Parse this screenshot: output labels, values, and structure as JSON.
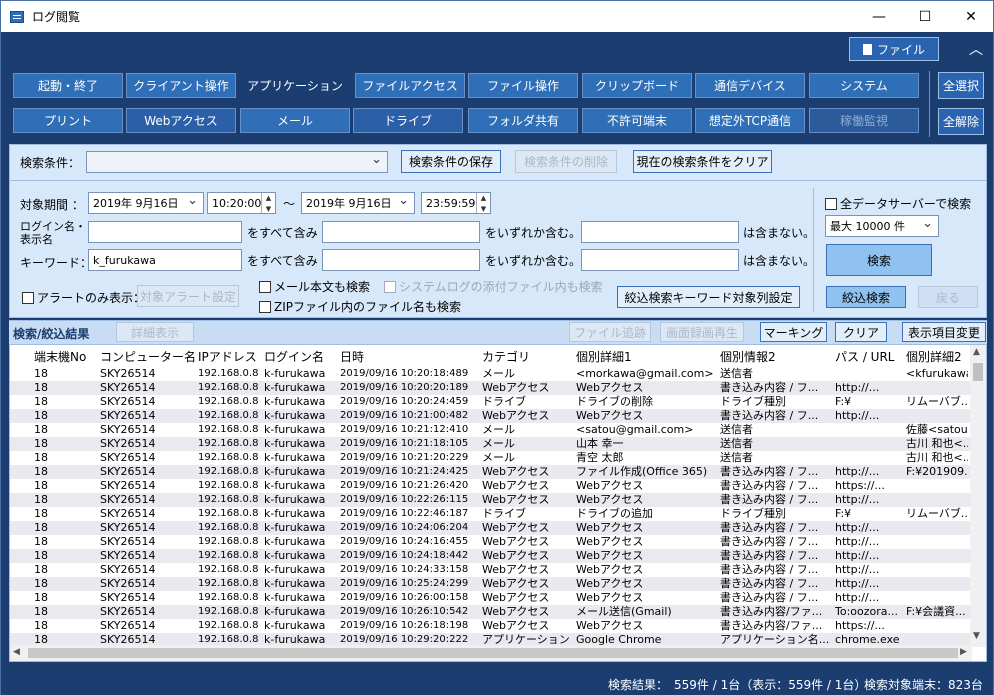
{
  "window": {
    "title": "ログ閲覧",
    "minimize": "—",
    "maximize": "☐",
    "close": "✕"
  },
  "header": {
    "file_button": "ファイル",
    "collapse": "︿"
  },
  "categories_row1": [
    "起動・終了",
    "クライアント操作",
    "アプリケーション",
    "ファイルアクセス",
    "ファイル操作",
    "クリップボード",
    "通信デバイス",
    "システム"
  ],
  "categories_row2": [
    "プリント",
    "Webアクセス",
    "メール",
    "ドライブ",
    "フォルダ共有",
    "不許可端末",
    "想定外TCP通信",
    "稼働監視"
  ],
  "select_all": "全選択",
  "deselect_all": "全解除",
  "search": {
    "condition_label": "検索条件：",
    "condition_value": "",
    "save_btn": "検索条件の保存",
    "delete_btn": "検索条件の削除",
    "clear_btn": "現在の検索条件をクリア",
    "period_label": "対象期間 ：",
    "date_from": "2019年 9月16日",
    "time_from": "10:20:00",
    "tilde": "〜",
    "date_to": "2019年 9月16日",
    "time_to": "23:59:59",
    "login_label1": "ログイン名・",
    "login_label2": "表示名",
    "all_contain": "をすべて含み",
    "any_contain": "をいずれか含む。",
    "not_contain": "は含まない。",
    "keyword_label": "キーワード：",
    "keyword_value": "k_furukawa",
    "alert_only": "アラートのみ表示：",
    "alert_setting": "対象アラート設定",
    "mail_body": "メール本文も検索",
    "syslog_attach": "システムログの添付ファイル内も検索",
    "zip_name": "ZIPファイル内のファイル名も検索",
    "refine_kw": "絞込検索キーワード対象列設定",
    "all_servers": "全データサーバーで検索",
    "max_label": "最大 10000 件",
    "search_btn": "検索",
    "refine_btn": "絞込検索",
    "back_btn": "戻る"
  },
  "results": {
    "title": "検索/絞込結果",
    "detail_btn": "詳細表示",
    "file_trace_btn": "ファイル追跡",
    "screen_play_btn": "画面録画再生",
    "marking_btn": "マーキング",
    "clear_btn": "クリア",
    "columns_btn": "表示項目変更",
    "columns": [
      "端末機No",
      "コンピューター名",
      "IPアドレス",
      "ログイン名",
      "日時",
      "カテゴリ",
      "個別詳細1",
      "個別情報2",
      "パス / URL",
      "個別詳細2"
    ],
    "rows": [
      [
        "18",
        "SKY26514",
        "192.168.0.8",
        "k-furukawa",
        "2019/09/16 10:20:18:489",
        "メール",
        "<morkawa@gmail.com>",
        "送信者",
        "",
        "<kfurukawa..."
      ],
      [
        "18",
        "SKY26514",
        "192.168.0.8",
        "k-furukawa",
        "2019/09/16 10:20:20:189",
        "Webアクセス",
        "Webアクセス",
        "書き込み内容 / フ...",
        "http://...",
        ""
      ],
      [
        "18",
        "SKY26514",
        "192.168.0.8",
        "k-furukawa",
        "2019/09/16 10:20:24:459",
        "ドライブ",
        "ドライブの削除",
        "ドライブ種別",
        "F:¥",
        "リムーバブ..."
      ],
      [
        "18",
        "SKY26514",
        "192.168.0.8",
        "k-furukawa",
        "2019/09/16 10:21:00:482",
        "Webアクセス",
        "Webアクセス",
        "書き込み内容 / フ...",
        "http://...",
        ""
      ],
      [
        "18",
        "SKY26514",
        "192.168.0.8",
        "k-furukawa",
        "2019/09/16 10:21:12:410",
        "メール",
        "<satou@gmail.com>",
        "送信者",
        "",
        "佐藤<satou..."
      ],
      [
        "18",
        "SKY26514",
        "192.168.0.8",
        "k-furukawa",
        "2019/09/16 10:21:18:105",
        "メール",
        "山本 幸一",
        "送信者",
        "",
        "古川 和也<..."
      ],
      [
        "18",
        "SKY26514",
        "192.168.0.8",
        "k-furukawa",
        "2019/09/16 10:21:20:229",
        "メール",
        "青空 太郎",
        "送信者",
        "",
        "古川 和也<..."
      ],
      [
        "18",
        "SKY26514",
        "192.168.0.8",
        "k-furukawa",
        "2019/09/16 10:21:24:425",
        "Webアクセス",
        "ファイル作成(Office 365)",
        "書き込み内容 / フ...",
        "http://...",
        "F:¥201909..."
      ],
      [
        "18",
        "SKY26514",
        "192.168.0.8",
        "k-furukawa",
        "2019/09/16 10:21:26:420",
        "Webアクセス",
        "Webアクセス",
        "書き込み内容 / フ...",
        "https://...",
        ""
      ],
      [
        "18",
        "SKY26514",
        "192.168.0.8",
        "k-furukawa",
        "2019/09/16 10:22:26:115",
        "Webアクセス",
        "Webアクセス",
        "書き込み内容 / フ...",
        "http://...",
        ""
      ],
      [
        "18",
        "SKY26514",
        "192.168.0.8",
        "k-furukawa",
        "2019/09/16 10:22:46:187",
        "ドライブ",
        "ドライブの追加",
        "ドライブ種別",
        "F:¥",
        "リムーバブ..."
      ],
      [
        "18",
        "SKY26514",
        "192.168.0.8",
        "k-furukawa",
        "2019/09/16 10:24:06:204",
        "Webアクセス",
        "Webアクセス",
        "書き込み内容 / フ...",
        "http://...",
        ""
      ],
      [
        "18",
        "SKY26514",
        "192.168.0.8",
        "k-furukawa",
        "2019/09/16 10:24:16:455",
        "Webアクセス",
        "Webアクセス",
        "書き込み内容 / フ...",
        "http://...",
        ""
      ],
      [
        "18",
        "SKY26514",
        "192.168.0.8",
        "k-furukawa",
        "2019/09/16 10:24:18:442",
        "Webアクセス",
        "Webアクセス",
        "書き込み内容 / フ...",
        "http://...",
        ""
      ],
      [
        "18",
        "SKY26514",
        "192.168.0.8",
        "k-furukawa",
        "2019/09/16 10:24:33:158",
        "Webアクセス",
        "Webアクセス",
        "書き込み内容 / フ...",
        "http://...",
        ""
      ],
      [
        "18",
        "SKY26514",
        "192.168.0.8",
        "k-furukawa",
        "2019/09/16 10:25:24:299",
        "Webアクセス",
        "Webアクセス",
        "書き込み内容 / フ...",
        "http://...",
        ""
      ],
      [
        "18",
        "SKY26514",
        "192.168.0.8",
        "k-furukawa",
        "2019/09/16 10:26:00:158",
        "Webアクセス",
        "Webアクセス",
        "書き込み内容 / フ...",
        "http://...",
        ""
      ],
      [
        "18",
        "SKY26514",
        "192.168.0.8",
        "k-furukawa",
        "2019/09/16 10:26:10:542",
        "Webアクセス",
        "メール送信(Gmail)",
        "書き込み内容/ファ...",
        "To:oozora...",
        "F:¥会議資..."
      ],
      [
        "18",
        "SKY26514",
        "192.168.0.8",
        "k-furukawa",
        "2019/09/16 10:26:18:198",
        "Webアクセス",
        "Webアクセス",
        "書き込み内容/ファ...",
        "https://...",
        ""
      ],
      [
        "18",
        "SKY26514",
        "192.168.0.8",
        "k-furukawa",
        "2019/09/16 10:29:20:222",
        "アプリケーション",
        "Google Chrome",
        "アプリケーション名...",
        "chrome.exe",
        ""
      ]
    ]
  },
  "status": {
    "results": "検索結果：　559件 / 1台（表示：559件 / 1台）",
    "targets": "検索対象端末：823台"
  }
}
